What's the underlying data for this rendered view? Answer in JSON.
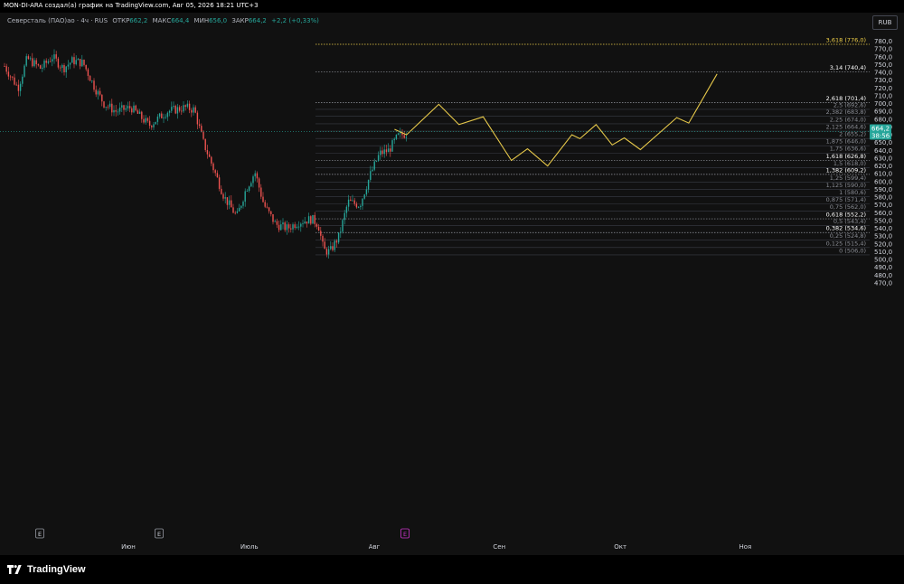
{
  "header": {
    "author_line": "MON-DI-ARA создал(а) график на TradingView.com, Авг 05, 2026 18:21 UTC+3"
  },
  "legend": {
    "symbol": "Северсталь (ПАО)ао · 4ч · RUS",
    "open_label": "ОТКР",
    "open_value": "662,2",
    "high_label": "МАКС",
    "high_value": "664,4",
    "low_label": "МИН",
    "low_value": "656,0",
    "close_label": "ЗАКР",
    "close_value": "664,2",
    "change": "+2,2 (+0,33%)"
  },
  "currency_button": "RUB",
  "price_axis": {
    "ticks": [
      "780,0",
      "770,0",
      "760,0",
      "750,0",
      "740,0",
      "730,0",
      "720,0",
      "710,0",
      "700,0",
      "690,0",
      "680,0",
      "670,0",
      "660,0",
      "650,0",
      "640,0",
      "630,0",
      "620,0",
      "610,0",
      "600,0",
      "590,0",
      "580,0",
      "570,0",
      "560,0",
      "550,0",
      "540,0",
      "530,0",
      "520,0",
      "510,0",
      "500,0",
      "490,0",
      "480,0",
      "470,0"
    ],
    "last_price": "664,2",
    "countdown": "38:56"
  },
  "time_axis": {
    "labels": [
      "Июн",
      "Июль",
      "Авг",
      "Сен",
      "Окт",
      "Ноя"
    ]
  },
  "event_markers": [
    "E",
    "E",
    "E"
  ],
  "fib_levels": [
    {
      "label": "3,618 (776,0)",
      "price": 776.0,
      "emphasis": "gold"
    },
    {
      "label": "3,14 (740,4)",
      "price": 740.4,
      "emphasis": "strong"
    },
    {
      "label": "2,618 (701,4)",
      "price": 701.4,
      "emphasis": "strong"
    },
    {
      "label": "2,5 (692,6)",
      "price": 692.6,
      "emphasis": "dim"
    },
    {
      "label": "2,382 (683,8)",
      "price": 683.8,
      "emphasis": "dim"
    },
    {
      "label": "2,25 (674,0)",
      "price": 674.0,
      "emphasis": "dim"
    },
    {
      "label": "2,125 (664,6)",
      "price": 664.6,
      "emphasis": "dim"
    },
    {
      "label": "2 (655,2)",
      "price": 655.2,
      "emphasis": "dim"
    },
    {
      "label": "1,875 (646,0)",
      "price": 646.0,
      "emphasis": "dim"
    },
    {
      "label": "1,75 (636,6)",
      "price": 636.6,
      "emphasis": "dim"
    },
    {
      "label": "1,618 (626,8)",
      "price": 626.8,
      "emphasis": "strong"
    },
    {
      "label": "1,5 (618,0)",
      "price": 618.0,
      "emphasis": "dim"
    },
    {
      "label": "1,382 (609,2)",
      "price": 609.2,
      "emphasis": "strong"
    },
    {
      "label": "1,25 (599,4)",
      "price": 599.4,
      "emphasis": "dim"
    },
    {
      "label": "1,125 (590,0)",
      "price": 590.0,
      "emphasis": "dim"
    },
    {
      "label": "1 (580,6)",
      "price": 580.6,
      "emphasis": "dim"
    },
    {
      "label": "0,875 (571,4)",
      "price": 571.4,
      "emphasis": "dim"
    },
    {
      "label": "0,75 (562,0)",
      "price": 562.0,
      "emphasis": "dim"
    },
    {
      "label": "0,618 (552,2)",
      "price": 552.2,
      "emphasis": "strong"
    },
    {
      "label": "0,5 (543,4)",
      "price": 543.4,
      "emphasis": "dim"
    },
    {
      "label": "0,382 (534,6)",
      "price": 534.6,
      "emphasis": "strong"
    },
    {
      "label": "0,25 (524,8)",
      "price": 524.8,
      "emphasis": "dim"
    },
    {
      "label": "0,125 (515,4)",
      "price": 515.4,
      "emphasis": "dim"
    },
    {
      "label": "0 (506,0)",
      "price": 506.0,
      "emphasis": "dim"
    }
  ],
  "projection_path": [
    {
      "date": "2026-08-06",
      "price": 667
    },
    {
      "date": "2026-08-09",
      "price": 660
    },
    {
      "date": "2026-08-17",
      "price": 699
    },
    {
      "date": "2026-08-22",
      "price": 673
    },
    {
      "date": "2026-08-28",
      "price": 683
    },
    {
      "date": "2026-09-04",
      "price": 627
    },
    {
      "date": "2026-09-08",
      "price": 642
    },
    {
      "date": "2026-09-13",
      "price": 620
    },
    {
      "date": "2026-09-19",
      "price": 660
    },
    {
      "date": "2026-09-21",
      "price": 655
    },
    {
      "date": "2026-09-25",
      "price": 673
    },
    {
      "date": "2026-09-29",
      "price": 647
    },
    {
      "date": "2026-10-02",
      "price": 656
    },
    {
      "date": "2026-10-06",
      "price": 641
    },
    {
      "date": "2026-10-15",
      "price": 682
    },
    {
      "date": "2026-10-18",
      "price": 675
    },
    {
      "date": "2026-10-25",
      "price": 738
    }
  ],
  "colors": {
    "background": "#111111",
    "up": "#26a69a",
    "down": "#ef5350",
    "projection": "#e6c84a",
    "gold_level": "#f0d048",
    "last_price_badge": "#26a69a",
    "event_marker_highlight": "#c935c9"
  },
  "footer": {
    "brand": "TradingView"
  }
}
